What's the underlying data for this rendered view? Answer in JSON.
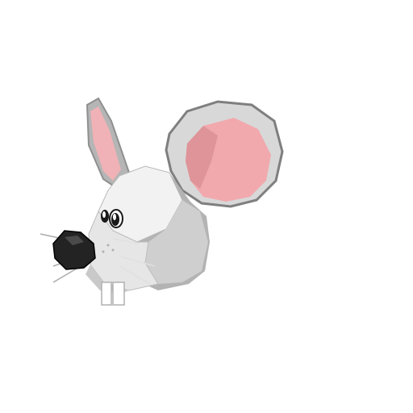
{
  "scene": {
    "subject": "mouse-head",
    "colors": {
      "background": "#ffffff",
      "fur_light": "#f2f2f2",
      "fur_mid": "#d4d4d4",
      "fur_dark": "#a9a9a9",
      "ear_rim": "#bdbdbd",
      "ear_inner_pink": "#f2a9ae",
      "ear_inner_dark": "#d98e94",
      "nose": "#222222",
      "eye": "#1a1a1a",
      "eye_highlight": "#ffffff",
      "whiskers": "#e6e6e6",
      "teeth": "#ffffff"
    }
  }
}
